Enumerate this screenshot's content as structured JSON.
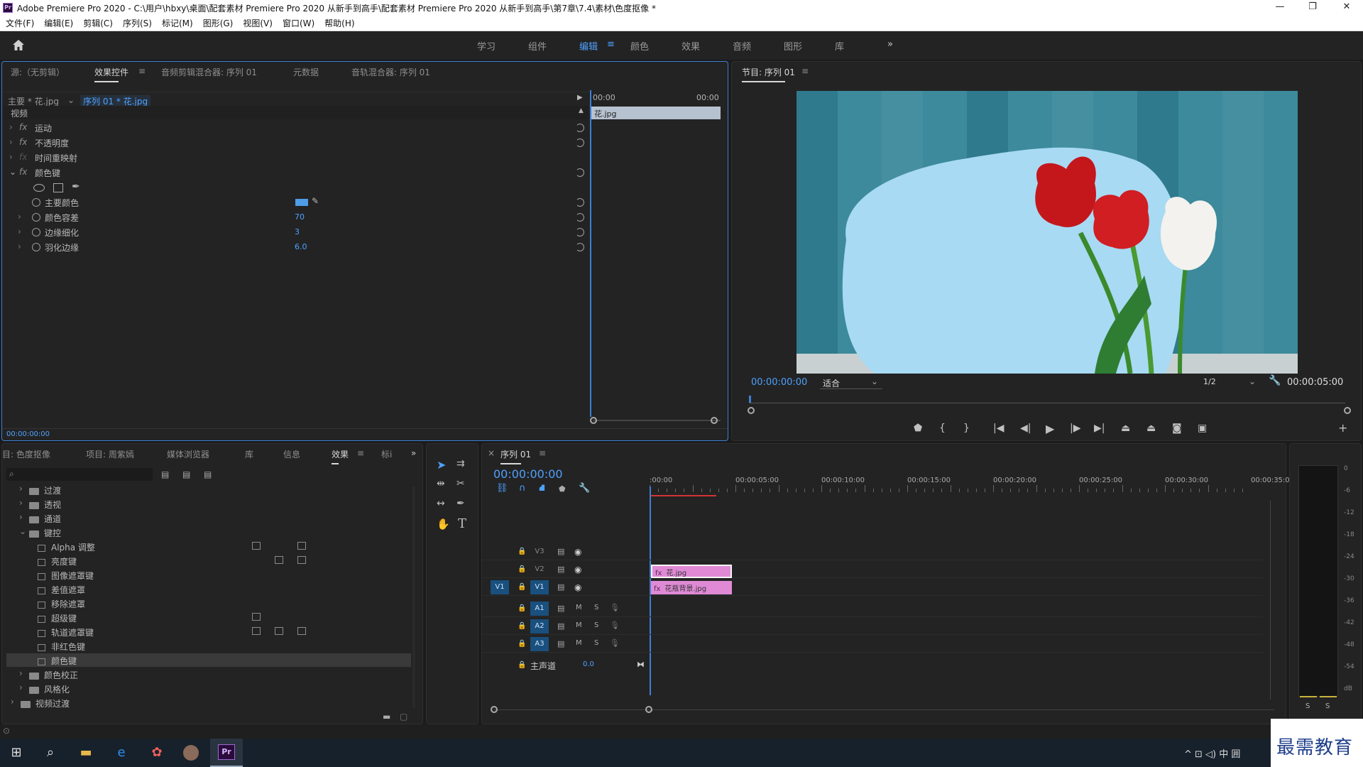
{
  "titlebar": {
    "title": "Adobe Premiere Pro 2020 - C:\\用户\\hbxy\\桌面\\配套素材 Premiere Pro 2020 从新手到高手\\配套素材 Premiere Pro 2020 从新手到高手\\第7章\\7.4\\素材\\色度抠像 *",
    "app_icon": "Pr",
    "min": "—",
    "max": "❐",
    "close": "✕"
  },
  "menu": [
    "文件(F)",
    "编辑(E)",
    "剪辑(C)",
    "序列(S)",
    "标记(M)",
    "图形(G)",
    "视图(V)",
    "窗口(W)",
    "帮助(H)"
  ],
  "workspaces": {
    "items": [
      "学习",
      "组件",
      "编辑",
      "颜色",
      "效果",
      "音频",
      "图形",
      "库"
    ],
    "active": "编辑",
    "more": "»"
  },
  "source_panel": {
    "tabs": [
      "源:（无剪辑）",
      "效果控件",
      "音频剪辑混合器: 序列 01",
      "元数据",
      "音轨混合器: 序列 01"
    ],
    "active_tab": "效果控件",
    "master_clip": "主要 * 花.jpg",
    "sequence_clip": "序列 01 * 花.jpg",
    "ruler_start": "00:00",
    "ruler_end": "00:00",
    "clip_bar": "花.jpg",
    "section": "视频",
    "effects": [
      {
        "label": "运动",
        "fx": "fx"
      },
      {
        "label": "不透明度",
        "fx": "fx"
      },
      {
        "label": "时间重映射",
        "fx": "fx"
      },
      {
        "label": "颜色键",
        "fx": "fx"
      }
    ],
    "params": [
      {
        "label": "主要颜色",
        "value": ""
      },
      {
        "label": "颜色容差",
        "value": "70"
      },
      {
        "label": "边缘细化",
        "value": "3"
      },
      {
        "label": "羽化边缘",
        "value": "6.0"
      }
    ],
    "key_color": "#4f9de8",
    "timecode": "00:00:00:00"
  },
  "program": {
    "title": "节目: 序列 01",
    "timecode": "00:00:00:00",
    "fit": "适合",
    "resolution": "1/2",
    "duration": "00:00:05:00",
    "plus": "+"
  },
  "project_panel": {
    "tabs": [
      "目: 色度抠像",
      "项目: 周紫嫣",
      "媒体浏览器",
      "库",
      "信息",
      "效果",
      "标i"
    ],
    "active_tab": "效果",
    "search_placeholder": "",
    "tree": [
      {
        "type": "folder",
        "label": "过渡",
        "depth": 1
      },
      {
        "type": "folder",
        "label": "透视",
        "depth": 1
      },
      {
        "type": "folder",
        "label": "通道",
        "depth": 1
      },
      {
        "type": "folder",
        "label": "键控",
        "depth": 1,
        "open": true
      },
      {
        "type": "item",
        "label": "Alpha 调整",
        "depth": 2
      },
      {
        "type": "item",
        "label": "亮度键",
        "depth": 2
      },
      {
        "type": "item",
        "label": "图像遮罩键",
        "depth": 2
      },
      {
        "type": "item",
        "label": "差值遮罩",
        "depth": 2
      },
      {
        "type": "item",
        "label": "移除遮罩",
        "depth": 2
      },
      {
        "type": "item",
        "label": "超级键",
        "depth": 2
      },
      {
        "type": "item",
        "label": "轨道遮罩键",
        "depth": 2
      },
      {
        "type": "item",
        "label": "非红色键",
        "depth": 2
      },
      {
        "type": "item",
        "label": "颜色键",
        "depth": 2,
        "selected": true
      },
      {
        "type": "folder",
        "label": "颜色校正",
        "depth": 1
      },
      {
        "type": "folder",
        "label": "风格化",
        "depth": 1
      },
      {
        "type": "folder",
        "label": "视频过渡",
        "depth": 0
      }
    ]
  },
  "timeline": {
    "title": "序列 01",
    "timecode": "00:00:00:00",
    "ruler": [
      ":00:00",
      "00:00:05:00",
      "00:00:10:00",
      "00:00:15:00",
      "00:00:20:00",
      "00:00:25:00",
      "00:00:30:00",
      "00:00:35:00"
    ],
    "video_tracks": [
      "V3",
      "V2",
      "V1"
    ],
    "audio_tracks": [
      "A1",
      "A2",
      "A3"
    ],
    "src_v": "V1",
    "master": "主声道",
    "master_value": "0.0",
    "clips": [
      {
        "name": "花.jpg",
        "track": "V2"
      },
      {
        "name": "花瓶背景.jpg",
        "track": "V1"
      }
    ],
    "m": "M",
    "s": "S"
  },
  "meter": {
    "scale": [
      "0",
      "-6",
      "-12",
      "-18",
      "-24",
      "-30",
      "-36",
      "-42",
      "-48",
      "-54",
      "dB"
    ],
    "solo": [
      "S",
      "S"
    ]
  },
  "watermark": "最需教育",
  "taskbar": {
    "tray": "^  ⊡  ◁)  中  囲"
  }
}
